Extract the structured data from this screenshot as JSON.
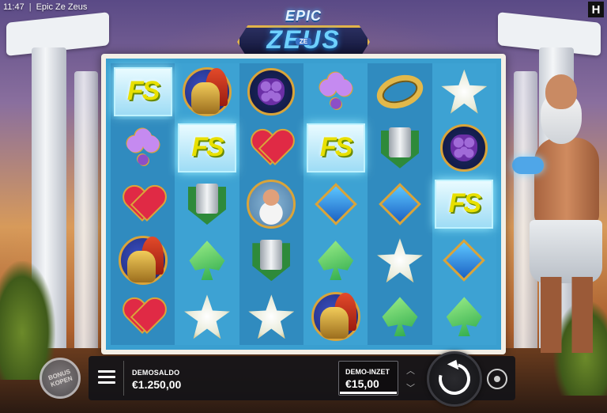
{
  "status_bar": {
    "time": "11:47",
    "separator": "|",
    "app_title": "Epic Ze Zeus"
  },
  "brand_mark": "H",
  "logo": {
    "top": "EPIC",
    "badge": "ZE",
    "main": "ZEUS"
  },
  "reels": {
    "columns": [
      [
        "fs-scatter",
        "club",
        "heart",
        "helmet",
        "heart"
      ],
      [
        "helmet",
        "fs-scatter",
        "column",
        "spade",
        "star"
      ],
      [
        "grapes",
        "heart",
        "zeus-face",
        "column",
        "star"
      ],
      [
        "club",
        "fs-scatter",
        "diamond",
        "spade",
        "helmet"
      ],
      [
        "ring",
        "column",
        "diamond",
        "star",
        "spade"
      ],
      [
        "star",
        "grapes",
        "fs-scatter",
        "diamond",
        "spade"
      ]
    ],
    "scatter_text": "FS"
  },
  "bottom_bar": {
    "balance_label": "DEMOSALDO",
    "balance_value": "€1.250,00",
    "bet_label": "DEMO-INZET",
    "bet_value": "€15,00",
    "bet_up_icon": "chevron-up-icon",
    "bet_down_icon": "chevron-down-icon",
    "bet_up_glyph": "︿",
    "bet_down_glyph": "﹀",
    "menu_icon": "menu-icon",
    "spin_icon": "spin-icon",
    "autoplay_icon": "autoplay-icon",
    "bonus_label_line1": "BONUS",
    "bonus_label_line2": "KOPEN"
  },
  "colors": {
    "reel_background": "#3a9fd0",
    "frame": "#f3efe6",
    "bar_background": "#141418"
  }
}
